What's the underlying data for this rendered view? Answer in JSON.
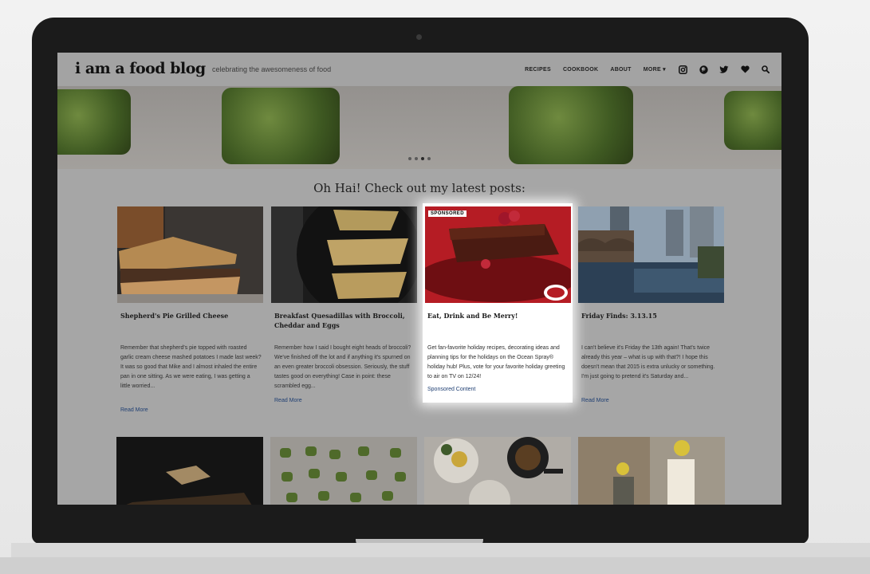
{
  "site": {
    "logo": "i am a food blog",
    "tagline": "celebrating the awesomeness of food"
  },
  "nav": {
    "items": [
      {
        "label": "RECIPES"
      },
      {
        "label": "COOKBOOK"
      },
      {
        "label": "ABOUT"
      },
      {
        "label": "MORE ▾"
      }
    ],
    "icons": [
      "instagram-icon",
      "pinterest-icon",
      "twitter-icon",
      "heart-icon",
      "search-icon"
    ]
  },
  "hero": {
    "slide_count": 4,
    "active_slide": 3
  },
  "section": {
    "heading": "Oh Hai! Check out my latest posts:"
  },
  "posts": [
    {
      "title": "Shepherd's Pie Grilled Cheese",
      "excerpt": "Remember that shepherd's pie topped with roasted garlic cream cheese mashed potatoes I made last week? It was so good that Mike and I almost inhaled the entire pan in one sitting. As we were eating, I was getting a little worried...",
      "link": "Read More"
    },
    {
      "title": "Breakfast Quesadillas with Broccoli, Cheddar and Eggs",
      "excerpt": "Remember how I said I bought eight heads of broccoli? We've finished off the lot and if anything it's spurned on an even greater broccoli obsession. Seriously, the stuff tastes good on everything! Case in point: these scrambled egg...",
      "link": "Read More"
    },
    {
      "tag": "SPONSORED",
      "title": "Eat, Drink and Be Merry!",
      "excerpt": "Get fan-favorite holiday recipes, decorating ideas and planning tips for the holidays on the Ocean Spray® holiday hub! Plus, vote for your favorite holiday greeting to air on TV on 12/24!",
      "link": "Sponsored Content"
    },
    {
      "title": "Friday Finds: 3.13.15",
      "excerpt": "I can't believe it's Friday the 13th again! That's twice already this year – what is up with that?! I hope this doesn't mean that 2015 is extra unlucky or something. I'm just going to pretend it's Saturday and...",
      "link": "Read More"
    }
  ],
  "colors": {
    "overlay": "#a6a6a6",
    "link": "#1f3f73",
    "laptop_bezel": "#1b1b1b"
  }
}
